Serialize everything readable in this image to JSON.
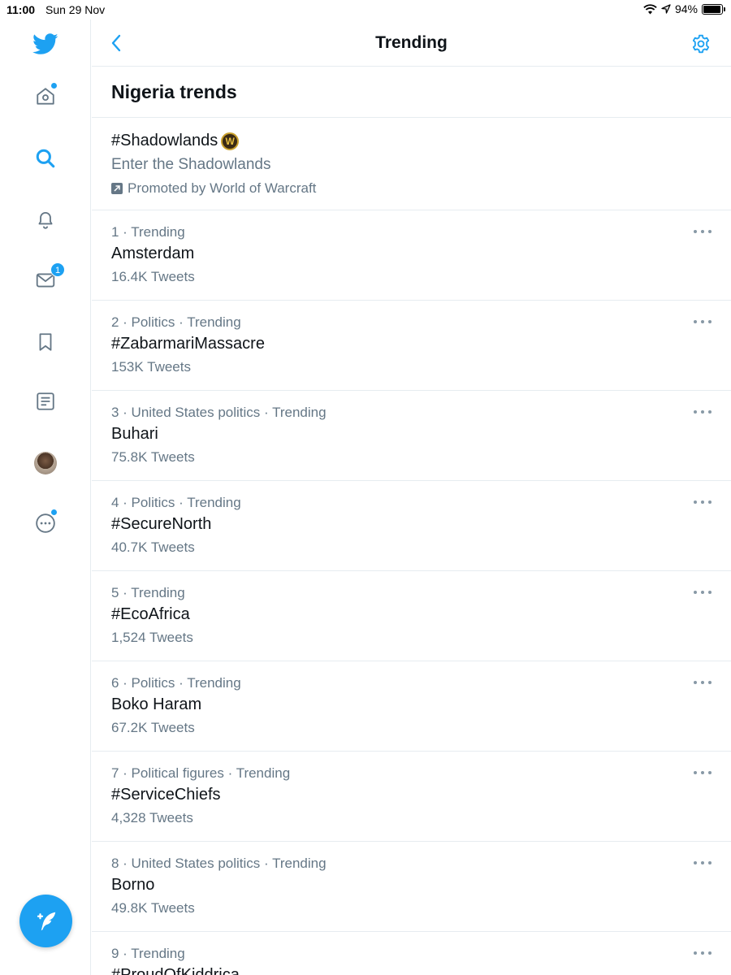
{
  "status_bar": {
    "time": "11:00",
    "date": "Sun 29 Nov",
    "battery": "94%",
    "battery_level": 0.94
  },
  "sidebar": {
    "items": [
      {
        "name": "twitter-logo-icon",
        "icon": "twitter-bird"
      },
      {
        "name": "home-icon",
        "icon": "home",
        "has_dot": true
      },
      {
        "name": "search-icon",
        "icon": "search",
        "active": true
      },
      {
        "name": "notifications-icon",
        "icon": "bell"
      },
      {
        "name": "messages-icon",
        "icon": "envelope",
        "badge": "1"
      },
      {
        "name": "bookmarks-icon",
        "icon": "bookmark"
      },
      {
        "name": "lists-icon",
        "icon": "list"
      },
      {
        "name": "profile-avatar",
        "icon": "avatar"
      },
      {
        "name": "more-icon",
        "icon": "more-circle",
        "has_dot": true
      }
    ],
    "compose": {
      "icon": "compose-feather"
    }
  },
  "header": {
    "title": "Trending",
    "back_icon": "chevron-left",
    "settings_icon": "gear"
  },
  "section": {
    "title": "Nigeria trends"
  },
  "promoted": {
    "title": "#Shadowlands",
    "badge_letter": "W",
    "subtitle": "Enter the Shadowlands",
    "by": "Promoted by World of Warcraft"
  },
  "trends": [
    {
      "context": "1 · Trending",
      "name": "Amsterdam",
      "count": "16.4K Tweets"
    },
    {
      "context": "2 · Politics · Trending",
      "name": "#ZabarmariMassacre",
      "count": "153K Tweets"
    },
    {
      "context": "3 · United States politics · Trending",
      "name": "Buhari",
      "count": "75.8K Tweets"
    },
    {
      "context": "4 · Politics · Trending",
      "name": "#SecureNorth",
      "count": "40.7K Tweets"
    },
    {
      "context": "5 · Trending",
      "name": "#EcoAfrica",
      "count": "1,524 Tweets"
    },
    {
      "context": "6 · Politics · Trending",
      "name": "Boko Haram",
      "count": "67.2K Tweets"
    },
    {
      "context": "7 · Political figures · Trending",
      "name": "#ServiceChiefs",
      "count": "4,328 Tweets"
    },
    {
      "context": "8 · United States politics · Trending",
      "name": "Borno",
      "count": "49.8K Tweets"
    },
    {
      "context": "9 · Trending",
      "name": "#ProudOfKiddrica",
      "count": ""
    }
  ],
  "colors": {
    "accent": "#1da1f2",
    "text": "#0f1419",
    "muted": "#657786",
    "divider": "#e6ecf0"
  }
}
